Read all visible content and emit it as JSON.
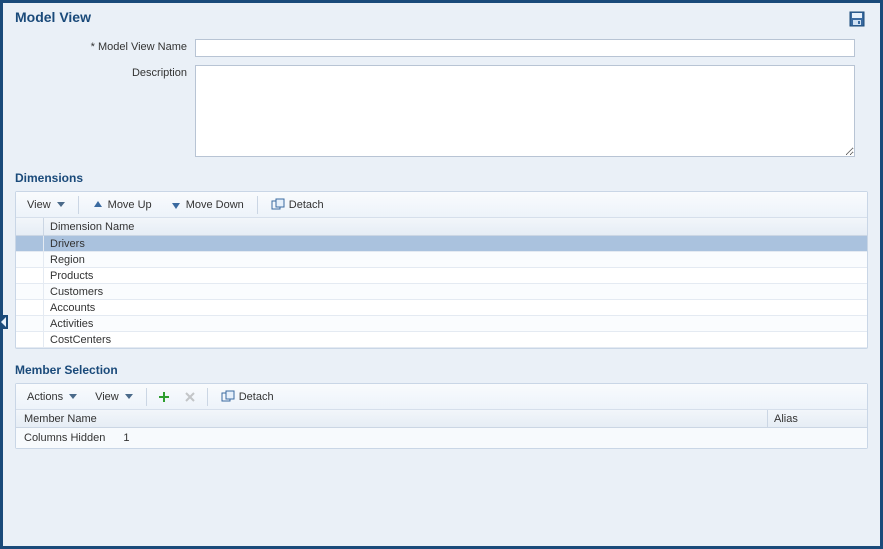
{
  "header": {
    "title": "Model View"
  },
  "form": {
    "name_label": "Model View Name",
    "required_marker": "*",
    "name_value": "",
    "description_label": "Description",
    "description_value": ""
  },
  "dimensions": {
    "title": "Dimensions",
    "toolbar": {
      "view_label": "View",
      "move_up_label": "Move Up",
      "move_down_label": "Move Down",
      "detach_label": "Detach"
    },
    "columns": {
      "name": "Dimension Name"
    },
    "rows": [
      {
        "name": "Drivers",
        "selected": true
      },
      {
        "name": "Region",
        "selected": false
      },
      {
        "name": "Products",
        "selected": false
      },
      {
        "name": "Customers",
        "selected": false
      },
      {
        "name": "Accounts",
        "selected": false
      },
      {
        "name": "Activities",
        "selected": false
      },
      {
        "name": "CostCenters",
        "selected": false
      }
    ]
  },
  "members": {
    "title": "Member Selection",
    "toolbar": {
      "actions_label": "Actions",
      "view_label": "View",
      "detach_label": "Detach"
    },
    "columns": {
      "name": "Member Name",
      "alias": "Alias"
    },
    "status": {
      "columns_hidden_label": "Columns Hidden",
      "columns_hidden_count": "1"
    }
  }
}
